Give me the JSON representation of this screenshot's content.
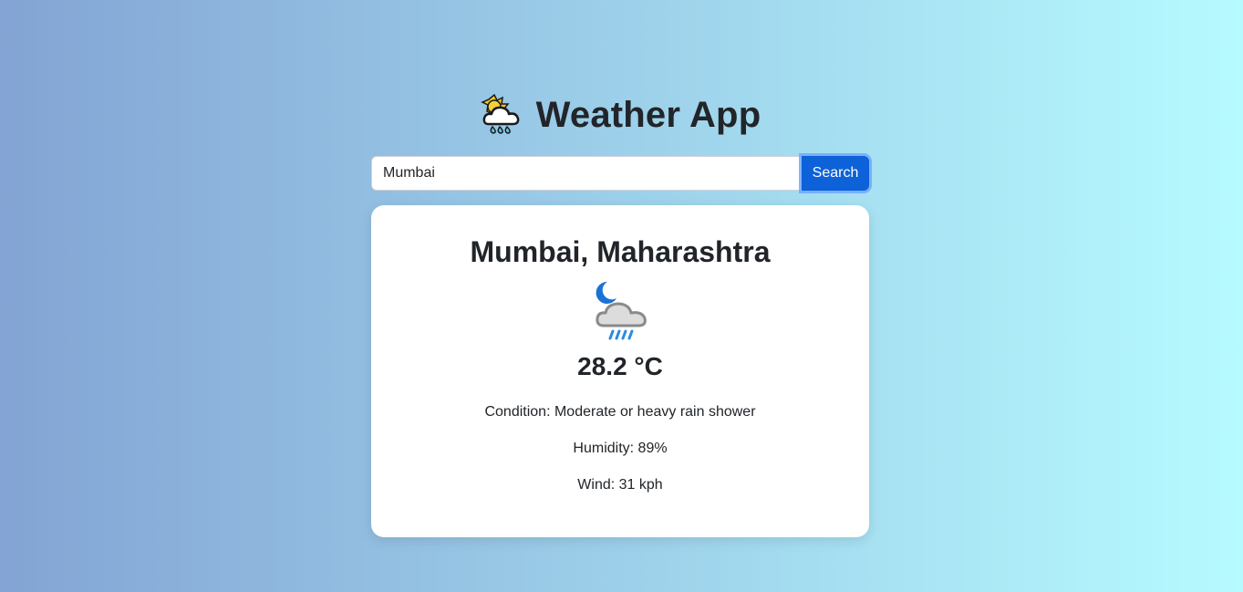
{
  "header": {
    "title": "Weather App",
    "icon": "sun-behind-rain-cloud-icon"
  },
  "search": {
    "value": "Mumbai",
    "placeholder": "",
    "button_label": "Search"
  },
  "weather": {
    "location": "Mumbai, Maharashtra",
    "icon": "night-rain-cloud-icon",
    "temperature": "28.2 °C",
    "condition": "Condition: Moderate or heavy rain shower",
    "humidity": "Humidity: 89%",
    "wind": "Wind: 31 kph"
  },
  "colors": {
    "gradient_start": "#83a4d4",
    "gradient_end": "#b6fbff",
    "button": "#0d62d9",
    "card": "#ffffff",
    "text": "#212529"
  }
}
